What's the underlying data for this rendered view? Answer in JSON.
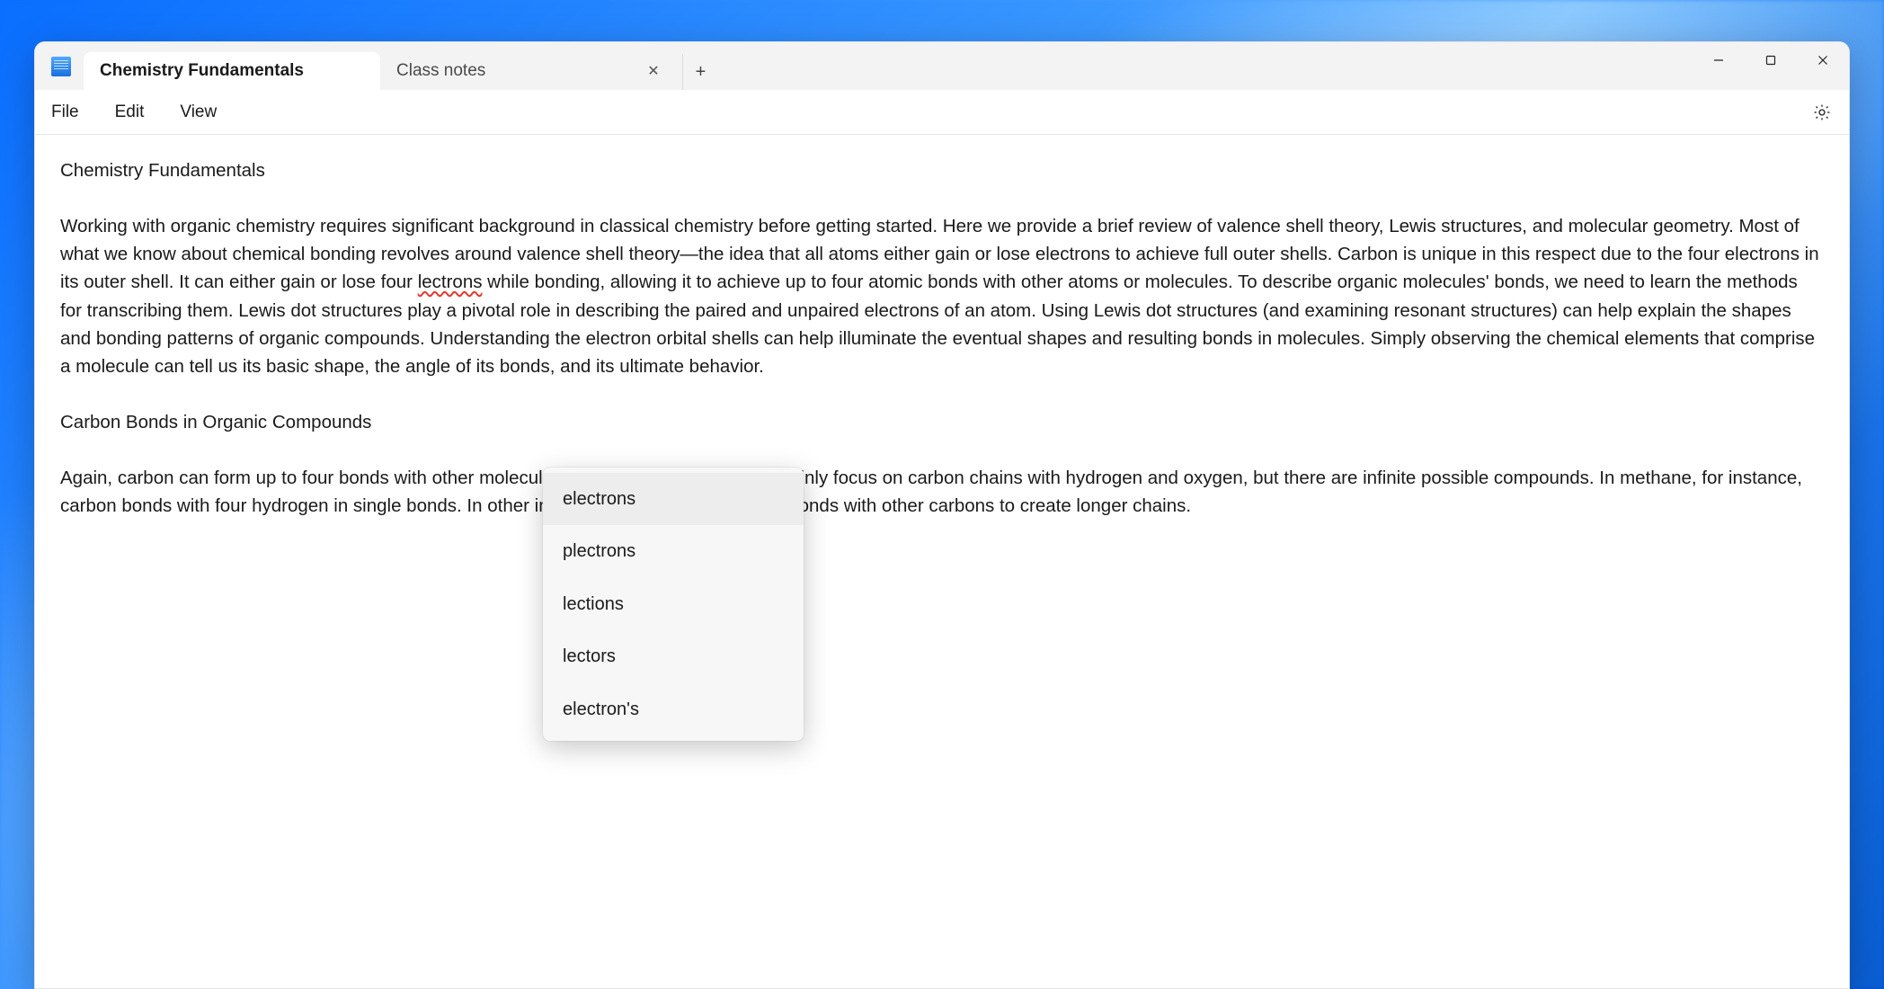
{
  "tabs": {
    "active": {
      "label": "Chemistry Fundamentals"
    },
    "inactive": [
      {
        "label": "Class notes"
      }
    ]
  },
  "menu": {
    "file": "File",
    "edit": "Edit",
    "view": "View"
  },
  "editor": {
    "title": "Chemistry Fundamentals",
    "p1a": "Working with organic chemistry requires significant background in classical chemistry before getting started. Here we provide a brief review of valence shell theory, Lewis structures, and molecular geometry. Most of what we know about chemical bonding revolves around valence shell theory—the idea that all atoms either gain or lose electrons to achieve full outer shells. Carbon is unique in this respect due to the four electrons in its outer shell. It can either gain or lose four ",
    "misspelled": "lectrons",
    "p1b": " while bonding, allowing it to achieve up to four atomic bonds with other atoms or molecules. To describe organic molecules' bonds, we need to learn the methods for transcribing them. Lewis dot structures play a pivotal role in describing the paired and unpaired electrons of an atom. Using Lewis dot structures (and examining resonant structures) can help explain the shapes and bonding patterns of organic compounds. Understanding the electron orbital shells can help illuminate the eventual shapes and resulting bonds in molecules. Simply observing the chemical elements that comprise a molecule can tell us its basic shape, the angle of its bonds, and its ultimate behavior.",
    "h2": "Carbon Bonds in Organic Compounds",
    "p2": "Again, carbon can form up to four bonds with other molecules. In organic chemistry, we mainly focus on carbon chains with hydrogen and oxygen, but there are infinite possible compounds. In methane, for instance, carbon bonds with four hydrogen in single bonds. In other instances, carbon forms single bonds with other carbons to create longer chains."
  },
  "spellcheck": {
    "suggestions": [
      "electrons",
      "plectrons",
      "lections",
      "lectors",
      "electron's"
    ]
  },
  "icons": {
    "close_glyph": "✕",
    "plus_glyph": "+"
  }
}
